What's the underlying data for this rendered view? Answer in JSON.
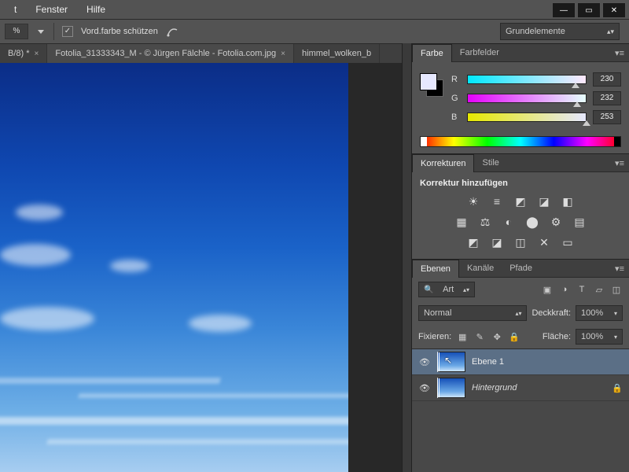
{
  "menu": {
    "fenster": "Fenster",
    "hilfe": "Hilfe"
  },
  "window_controls": {
    "min": "—",
    "max": "▭",
    "close": "✕"
  },
  "options_bar": {
    "value": "%",
    "checkbox_checked": "✓",
    "protect_fg": "Vord.farbe schützen",
    "workspace": "Grundelemente"
  },
  "tabs": {
    "t1": "B/8) *",
    "t2": "Fotolia_31333343_M - © Jürgen Fälchle - Fotolia.com.jpg",
    "t3": "himmel_wolken_b",
    "more": "≫"
  },
  "panel_menu": "▾≡",
  "color_panel": {
    "tab_farbe": "Farbe",
    "tab_farbfelder": "Farbfelder",
    "r_label": "R",
    "g_label": "G",
    "b_label": "B",
    "r_value": "230",
    "g_value": "232",
    "b_value": "253"
  },
  "korrektur_panel": {
    "tab_korrekturen": "Korrekturen",
    "tab_stile": "Stile",
    "header": "Korrektur hinzufügen",
    "row1": {
      "i1": "☀",
      "i2": "≡",
      "i3": "◩",
      "i4": "◪",
      "i5": "◧"
    },
    "row2": {
      "i1": "▦",
      "i2": "⚖",
      "i3": "◐",
      "i4": "⬤",
      "i5": "⚙",
      "i6": "▤"
    },
    "row3": {
      "i1": "◩",
      "i2": "◪",
      "i3": "◫",
      "i4": "✕",
      "i5": "▭"
    }
  },
  "layers_panel": {
    "tab_ebenen": "Ebenen",
    "tab_kanaele": "Kanäle",
    "tab_pfade": "Pfade",
    "filter_label": "Art",
    "search_icon": "🔍",
    "ic_img": "▣",
    "ic_fx": "◑",
    "ic_t": "T",
    "ic_shape": "▱",
    "ic_smart": "◫",
    "blend_mode": "Normal",
    "opacity_label": "Deckkraft:",
    "opacity_value": "100%",
    "lock_label": "Fixieren:",
    "lock_i1": "▦",
    "lock_i2": "✎",
    "lock_i3": "✥",
    "lock_i4": "🔒",
    "fill_label": "Fläche:",
    "fill_value": "100%",
    "eye": "👁",
    "layer1": "Ebene 1",
    "background": "Hintergrund",
    "lock_icon": "🔒",
    "cursor": "↖"
  }
}
